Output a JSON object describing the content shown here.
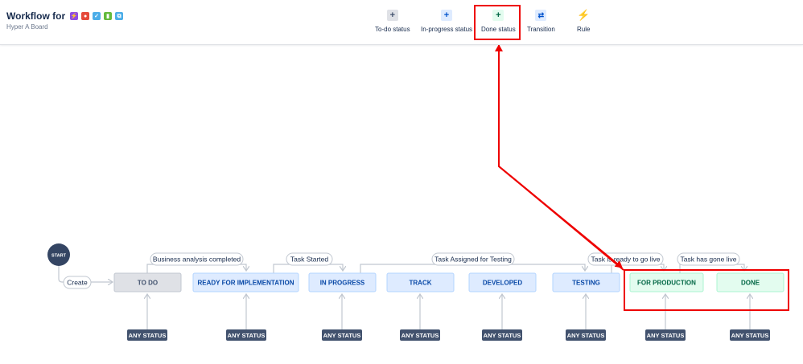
{
  "header": {
    "title": "Workflow for",
    "subtitle": "Hyper A Board",
    "type_icons": [
      {
        "name": "subtask-icon",
        "color": "#904ee2",
        "glyph": "⚡"
      },
      {
        "name": "bug-icon",
        "color": "#e5493a",
        "glyph": "●"
      },
      {
        "name": "task-icon",
        "color": "#4bade8",
        "glyph": "✓"
      },
      {
        "name": "story-icon",
        "color": "#63ba3c",
        "glyph": "▮"
      },
      {
        "name": "improvement-icon",
        "color": "#4bade8",
        "glyph": "⧉"
      }
    ],
    "tools": [
      {
        "name": "todo-status",
        "label": "To-do status",
        "icon": "plus-icon"
      },
      {
        "name": "inprogress-status",
        "label": "In-progress status",
        "icon": "plus-icon"
      },
      {
        "name": "done-status",
        "label": "Done status",
        "icon": "plus-icon"
      },
      {
        "name": "transition",
        "label": "Transition",
        "icon": "transition-icon"
      },
      {
        "name": "rule",
        "label": "Rule",
        "icon": "lightning-icon"
      }
    ]
  },
  "workflow": {
    "start_label": "START",
    "create_label": "Create",
    "any_status_label": "ANY STATUS",
    "statuses": [
      {
        "name": "status-todo",
        "label": "TO DO",
        "category": "todo"
      },
      {
        "name": "status-ready-for-implementation",
        "label": "READY FOR IMPLEMENTATION",
        "category": "inprogress"
      },
      {
        "name": "status-in-progress",
        "label": "IN PROGRESS",
        "category": "inprogress"
      },
      {
        "name": "status-track",
        "label": "TRACK",
        "category": "inprogress"
      },
      {
        "name": "status-developed",
        "label": "DEVELOPED",
        "category": "inprogress"
      },
      {
        "name": "status-testing",
        "label": "TESTING",
        "category": "inprogress"
      },
      {
        "name": "status-for-production",
        "label": "FOR PRODUCTION",
        "category": "done"
      },
      {
        "name": "status-done",
        "label": "DONE",
        "category": "done"
      }
    ],
    "transitions": [
      {
        "name": "transition-business-analysis-completed",
        "label": "Business analysis completed"
      },
      {
        "name": "transition-task-started",
        "label": "Task Started"
      },
      {
        "name": "transition-task-assigned-for-testing",
        "label": "Task Assigned for Testing"
      },
      {
        "name": "transition-task-is-ready-to-go-live",
        "label": "Task is ready to go live"
      },
      {
        "name": "transition-task-has-gone-live",
        "label": "Task has gone live"
      }
    ]
  },
  "colors": {
    "todo_bg": "#dfe1e6",
    "todo_border": "#c1c7d0",
    "todo_text": "#42526e",
    "inprogress_bg": "#deebff",
    "inprogress_border": "#b3d4ff",
    "inprogress_text": "#0747a6",
    "done_bg": "#e3fcef",
    "done_border": "#abf5d1",
    "done_text": "#006644",
    "any_status_bg": "#42526e",
    "start_bg": "#344563",
    "line": "#c1c7d0",
    "annotation": "#ee0000"
  }
}
